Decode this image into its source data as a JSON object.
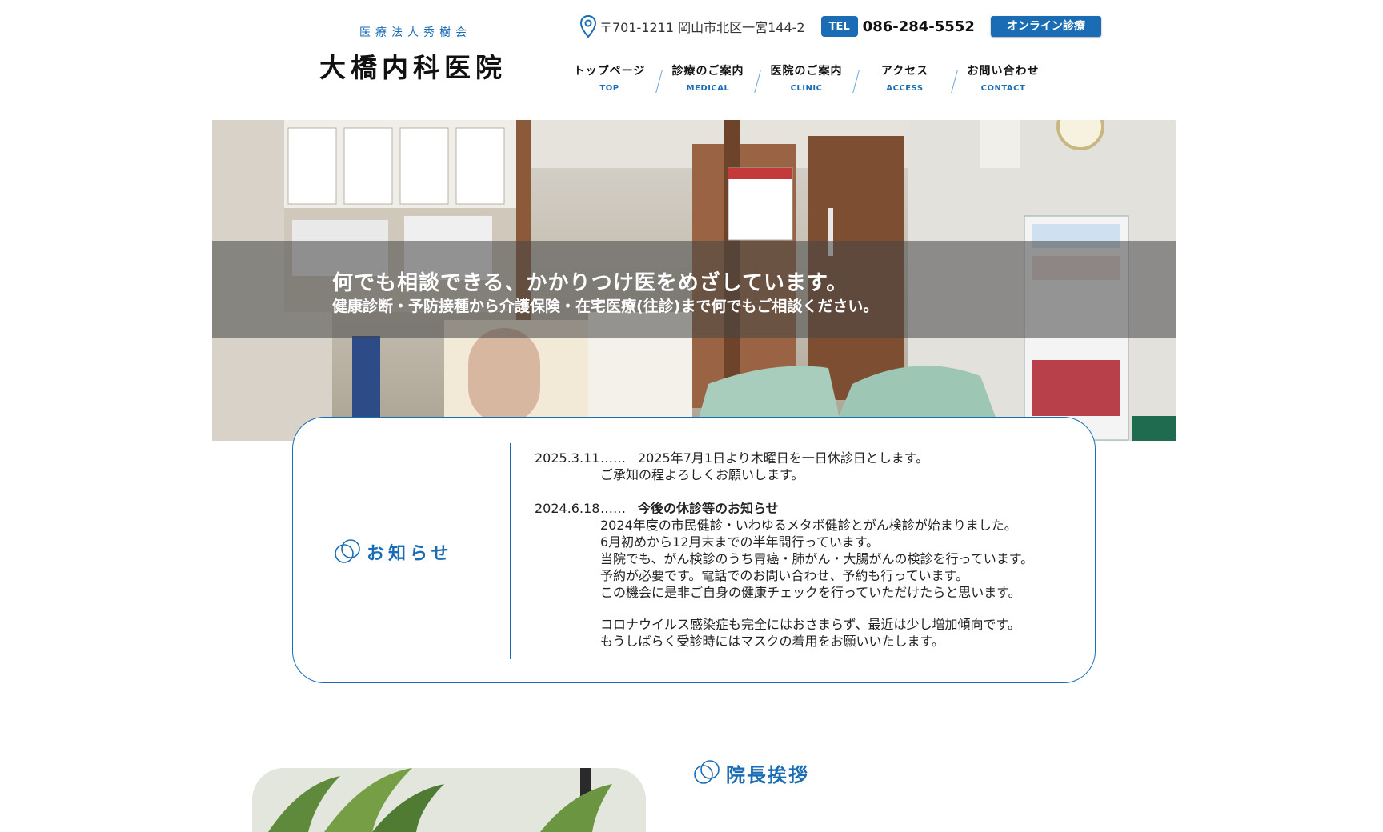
{
  "header": {
    "logo_sub": "医療法人秀樹会",
    "logo_main": "大橋内科医院",
    "address": "〒701-1211 岡山市北区一宮144-2",
    "tel_label": "TEL",
    "tel_number": "086-284-5552",
    "online_label": "オンライン診療"
  },
  "nav": [
    {
      "ja": "トップページ",
      "en": "TOP"
    },
    {
      "ja": "診療のご案内",
      "en": "MEDICAL"
    },
    {
      "ja": "医院のご案内",
      "en": "CLINIC"
    },
    {
      "ja": "アクセス",
      "en": "ACCESS"
    },
    {
      "ja": "お問い合わせ",
      "en": "CONTACT"
    }
  ],
  "hero": {
    "title": "何でも相談できる、かかりつけ医をめざしています。",
    "subtitle": "健康診断・予防接種から介護保険・在宅医療(往診)まで何でもご相談ください。"
  },
  "news": {
    "heading": "お知らせ",
    "items": [
      {
        "date": "2025.3.11",
        "dots": "……",
        "title": "2025年7月1日より木曜日を一日休診日とします。",
        "lines": [
          "ご承知の程よろしくお願いします。"
        ]
      },
      {
        "date": "2024.6.18",
        "dots": "……",
        "title": "今後の休診等のお知らせ",
        "lines": [
          "2024年度の市民健診・いわゆるメタボ健診とがん検診が始まりました。",
          "6月初めから12月末までの半年間行っています。",
          "当院でも、がん検診のうち胃癌・肺がん・大腸がんの検診を行っています。",
          "予約が必要です。電話でのお問い合わせ、予約も行っています。",
          "この機会に是非ご自身の健康チェックを行っていただけたらと思います。"
        ],
        "lines2": [
          "コロナウイルス感染症も完全にはおさまらず、最近は少し増加傾向です。",
          "もうしばらく受診時にはマスクの着用をお願いいたします。"
        ]
      }
    ]
  },
  "greeting": {
    "heading": "院長挨拶"
  },
  "colors": {
    "brand": "#1a6db5"
  }
}
